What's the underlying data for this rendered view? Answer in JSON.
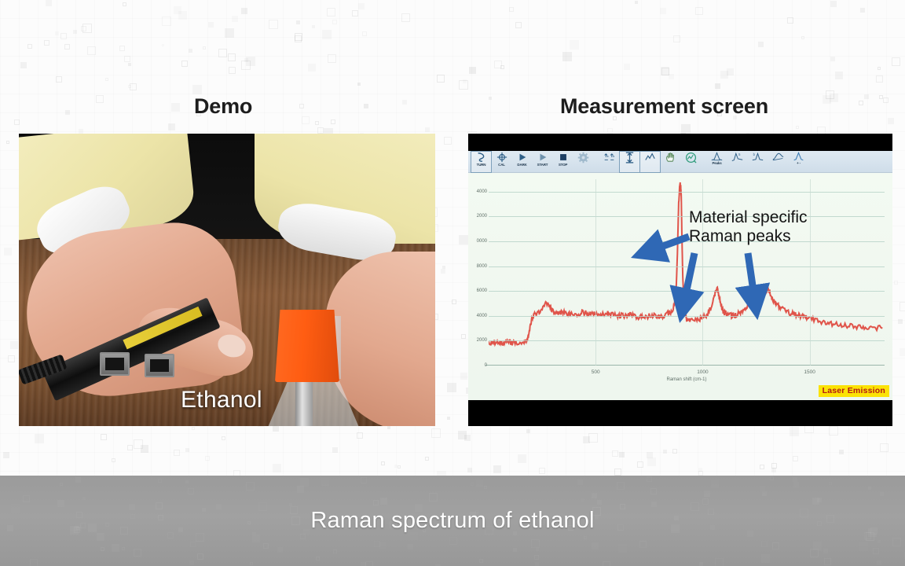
{
  "slide": {
    "caption": "Raman spectrum of ethanol"
  },
  "headings": {
    "left": "Demo",
    "right": "Measurement screen"
  },
  "photo": {
    "overlay_label": "Ethanol",
    "alt": "Hands holding a Raman probe against an Erlenmeyer flask with an orange cap on a wooden table"
  },
  "measurement": {
    "toolbar": [
      {
        "icon": "cursor-select-icon",
        "label": "TURN",
        "boxed": true
      },
      {
        "icon": "calibration-icon",
        "label": "CAL",
        "boxed": false
      },
      {
        "icon": "play-dark-icon",
        "label": "DARK",
        "boxed": false
      },
      {
        "icon": "play-start-icon",
        "label": "START",
        "boxed": false
      },
      {
        "icon": "stop-square-icon",
        "label": "STOP",
        "boxed": false
      },
      {
        "icon": "gear-settings-icon",
        "label": "",
        "boxed": false
      },
      {
        "icon": "scale-axes-icon",
        "label": "",
        "boxed": false
      },
      {
        "icon": "autoscale-y-icon",
        "label": "",
        "boxed": true
      },
      {
        "icon": "zoom-region-icon",
        "label": "",
        "boxed": true
      },
      {
        "icon": "pan-hand-icon",
        "label": "",
        "boxed": false
      },
      {
        "icon": "live-view-icon",
        "label": "",
        "boxed": false
      },
      {
        "icon": "peak-find-icon",
        "label": "Peaks",
        "boxed": false
      },
      {
        "icon": "peak-left-icon",
        "label": "",
        "boxed": false
      },
      {
        "icon": "peak-right-icon",
        "label": "",
        "boxed": false
      },
      {
        "icon": "baseline-icon",
        "label": "",
        "boxed": false
      },
      {
        "icon": "peak-addremove-icon",
        "label": "+ -",
        "boxed": false
      }
    ],
    "annotation": {
      "line1": "Material specific",
      "line2": "Raman peaks"
    },
    "status_badge": "Laser Emission"
  },
  "chart_data": {
    "type": "line",
    "title": "",
    "xlabel": "Raman shift (cm-1)",
    "ylabel": "",
    "xlim": [
      0,
      1850
    ],
    "ylim": [
      0,
      15000
    ],
    "xticks": [
      500,
      1000,
      1500
    ],
    "yticks": [
      2000,
      4000,
      6000,
      8000,
      10000,
      12000,
      14000
    ],
    "ytick_labels": [
      "2000",
      "4000",
      "6000",
      "8000",
      "0000",
      "2000",
      "4000"
    ],
    "grid": true,
    "legend_position": "none",
    "line_color": "#e0544a",
    "series": [
      {
        "name": "Ethanol Raman spectrum",
        "x": [
          0,
          20,
          40,
          60,
          80,
          100,
          120,
          140,
          160,
          175,
          185,
          195,
          205,
          215,
          230,
          250,
          270,
          285,
          300,
          315,
          330,
          345,
          360,
          380,
          400,
          420,
          440,
          460,
          480,
          500,
          520,
          540,
          560,
          580,
          600,
          620,
          640,
          660,
          680,
          700,
          720,
          740,
          760,
          780,
          800,
          820,
          840,
          860,
          875,
          882,
          888,
          893,
          897,
          900,
          903,
          907,
          912,
          918,
          925,
          940,
          960,
          980,
          1000,
          1020,
          1040,
          1055,
          1065,
          1072,
          1078,
          1085,
          1092,
          1100,
          1110,
          1125,
          1140,
          1160,
          1180,
          1200,
          1215,
          1230,
          1245,
          1258,
          1268,
          1275,
          1282,
          1290,
          1298,
          1305,
          1315,
          1325,
          1340,
          1360,
          1380,
          1400,
          1420,
          1440,
          1460,
          1480,
          1500,
          1530,
          1560,
          1590,
          1620,
          1650,
          1680,
          1710,
          1740,
          1770,
          1800,
          1840
        ],
        "y": [
          1830,
          1900,
          1840,
          1780,
          1930,
          1870,
          1800,
          1880,
          1820,
          1900,
          2150,
          3200,
          3900,
          4100,
          4250,
          4500,
          5050,
          4700,
          4350,
          4200,
          4150,
          4300,
          4200,
          4100,
          4200,
          4150,
          4300,
          4200,
          4100,
          4250,
          4150,
          4050,
          4200,
          4100,
          3950,
          4050,
          3950,
          4100,
          4000,
          3900,
          4050,
          3950,
          4100,
          4000,
          3900,
          4050,
          4200,
          4350,
          5500,
          9000,
          13200,
          14600,
          14500,
          13600,
          10500,
          7200,
          5200,
          4200,
          3800,
          3700,
          3650,
          3700,
          3800,
          4100,
          4700,
          5600,
          6200,
          6050,
          5500,
          4900,
          4500,
          4250,
          4150,
          4050,
          4000,
          4100,
          4300,
          4600,
          4900,
          5300,
          5550,
          5400,
          5700,
          5800,
          5650,
          5850,
          6050,
          6200,
          5900,
          5400,
          5000,
          4700,
          4450,
          4300,
          4150,
          4050,
          3950,
          3850,
          3800,
          3650,
          3500,
          3400,
          3300,
          3250,
          3200,
          3150,
          3100,
          3080,
          3050,
          3000
        ]
      }
    ],
    "annotations": [
      {
        "text": "Material specific Raman peaks",
        "arrows": 3
      }
    ]
  }
}
